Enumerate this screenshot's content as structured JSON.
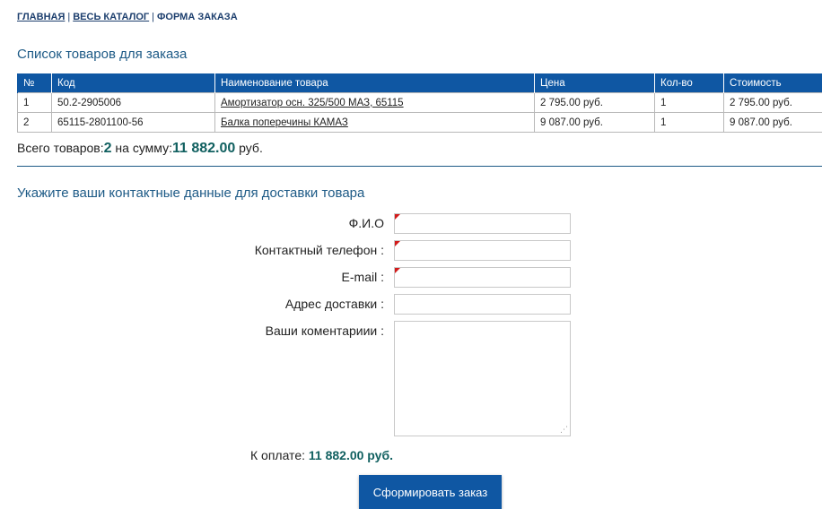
{
  "breadcrumb": {
    "home": "ГЛАВНАЯ",
    "catalog": "ВЕСЬ КАТАЛОГ",
    "current": "ФОРМА ЗАКАЗА",
    "separator": "|"
  },
  "list_title": "Список товаров для заказа",
  "table": {
    "headers": [
      "№",
      "Код",
      "Наименование товара",
      "Цена",
      "Кол-во",
      "Стоимость"
    ],
    "rows": [
      [
        "1",
        "50.2-2905006",
        "Амортизатор осн. 325/500 МАЗ, 65115",
        "2 795.00 руб.",
        "1",
        "2 795.00 руб."
      ],
      [
        "2",
        "65115-2801100-56",
        "Балка поперечины КАМАЗ",
        "9 087.00 руб.",
        "1",
        "9 087.00 руб."
      ]
    ]
  },
  "totals": {
    "prefix": "Всего товаров:",
    "count": "2",
    "middle": " на сумму:",
    "sum": "11 882.00",
    "suffix": " руб."
  },
  "contacts_title": "Укажите ваши контактные данные для доставки товара",
  "form": {
    "fio_label": "Ф.И.О",
    "phone_label": "Контактный телефон :",
    "email_label": "E-mail :",
    "address_label": "Адрес доставки :",
    "comment_label": "Ваши коментариии :",
    "fio_value": "",
    "phone_value": "",
    "email_value": "",
    "address_value": "",
    "comment_value": ""
  },
  "payment": {
    "label": "К оплате:",
    "amount": "11 882.00 руб."
  },
  "submit_label": "Сформировать заказ",
  "colors": {
    "header_blue": "#0f57a3",
    "title_blue": "#1d5a86",
    "total_teal": "#116060",
    "required_red": "#d21a1a"
  }
}
